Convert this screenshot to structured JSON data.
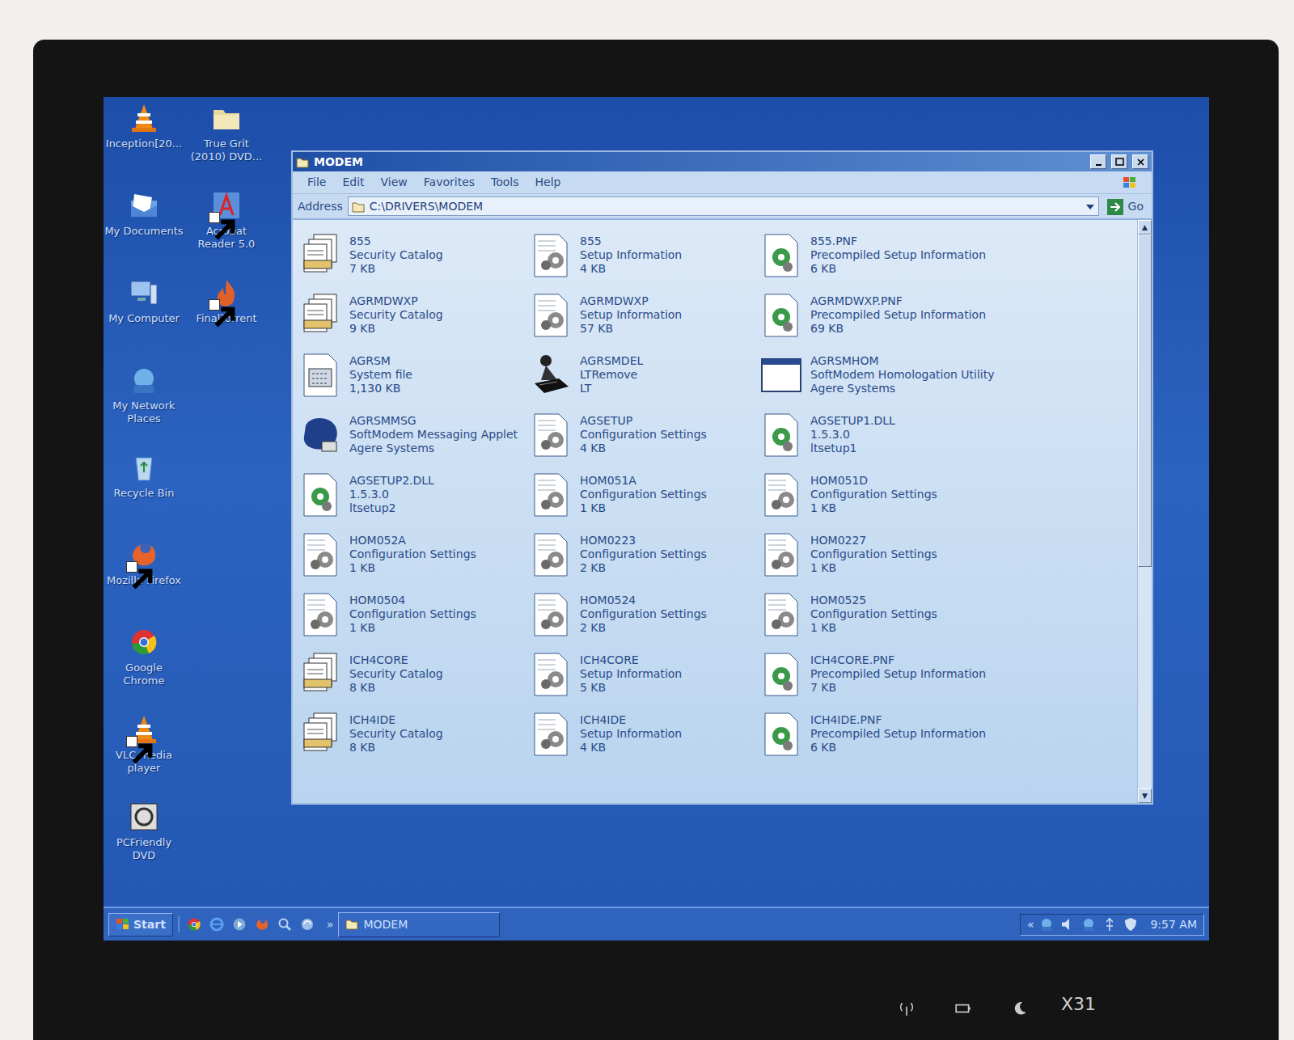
{
  "desktop": {
    "icons": [
      {
        "label": "Inception[20...",
        "kind": "vlc",
        "shortcut": false
      },
      {
        "label": "True Grit (2010) DVD...",
        "kind": "folder",
        "shortcut": false
      },
      {
        "label": "My Documents",
        "kind": "documents",
        "shortcut": false
      },
      {
        "label": "Acrobat Reader 5.0",
        "kind": "acrobat",
        "shortcut": true
      },
      {
        "label": "My Computer",
        "kind": "computer",
        "shortcut": false
      },
      {
        "label": "FinalTorrent",
        "kind": "torrent",
        "shortcut": true
      },
      {
        "label": "My Network Places",
        "kind": "network",
        "shortcut": false
      },
      {
        "label": "Recycle Bin",
        "kind": "recycle",
        "shortcut": false
      },
      {
        "label": "Mozilla Firefox",
        "kind": "firefox",
        "shortcut": true
      },
      {
        "label": "Google Chrome",
        "kind": "chrome",
        "shortcut": false
      },
      {
        "label": "VLC media player",
        "kind": "vlc",
        "shortcut": true
      },
      {
        "label": "PCFriendly DVD",
        "kind": "dvd",
        "shortcut": false
      }
    ]
  },
  "window": {
    "title": "MODEM",
    "menu": [
      "File",
      "Edit",
      "View",
      "Favorites",
      "Tools",
      "Help"
    ],
    "address_label": "Address",
    "address": "C:\\DRIVERS\\MODEM",
    "go": "Go",
    "scroll": {
      "level": 0.6
    }
  },
  "files": [
    {
      "name": "855",
      "lines": [
        "Security Catalog",
        "7 KB"
      ],
      "kind": "catalog"
    },
    {
      "name": "855",
      "lines": [
        "Setup Information",
        "4 KB"
      ],
      "kind": "setup"
    },
    {
      "name": "855.PNF",
      "lines": [
        "Precompiled Setup Information",
        "6 KB"
      ],
      "kind": "pnf"
    },
    {
      "name": "AGRMDWXP",
      "lines": [
        "Security Catalog",
        "9 KB"
      ],
      "kind": "catalog"
    },
    {
      "name": "AGRMDWXP",
      "lines": [
        "Setup Information",
        "57 KB"
      ],
      "kind": "setup"
    },
    {
      "name": "AGRMDWXP.PNF",
      "lines": [
        "Precompiled Setup Information",
        "69 KB"
      ],
      "kind": "pnf"
    },
    {
      "name": "AGRSM",
      "lines": [
        "System file",
        "1,130 KB"
      ],
      "kind": "system"
    },
    {
      "name": "AGRSMDEL",
      "lines": [
        "LTRemove",
        "LT"
      ],
      "kind": "remove"
    },
    {
      "name": "AGRSMHOM",
      "lines": [
        "SoftModem Homologation Utility",
        "Agere Systems"
      ],
      "kind": "app"
    },
    {
      "name": "AGRSMMSG",
      "lines": [
        "SoftModem Messaging Applet",
        "Agere Systems"
      ],
      "kind": "applet"
    },
    {
      "name": "AGSETUP",
      "lines": [
        "Configuration Settings",
        "4 KB"
      ],
      "kind": "setup"
    },
    {
      "name": "AGSETUP1.DLL",
      "lines": [
        "1.5.3.0",
        "ltsetup1"
      ],
      "kind": "pnf"
    },
    {
      "name": "AGSETUP2.DLL",
      "lines": [
        "1.5.3.0",
        "ltsetup2"
      ],
      "kind": "pnf"
    },
    {
      "name": "HOM051A",
      "lines": [
        "Configuration Settings",
        "1 KB"
      ],
      "kind": "setup"
    },
    {
      "name": "HOM051D",
      "lines": [
        "Configuration Settings",
        "1 KB"
      ],
      "kind": "setup"
    },
    {
      "name": "HOM052A",
      "lines": [
        "Configuration Settings",
        "1 KB"
      ],
      "kind": "setup"
    },
    {
      "name": "HOM0223",
      "lines": [
        "Configuration Settings",
        "2 KB"
      ],
      "kind": "setup"
    },
    {
      "name": "HOM0227",
      "lines": [
        "Configuration Settings",
        "1 KB"
      ],
      "kind": "setup"
    },
    {
      "name": "HOM0504",
      "lines": [
        "Configuration Settings",
        "1 KB"
      ],
      "kind": "setup"
    },
    {
      "name": "HOM0524",
      "lines": [
        "Configuration Settings",
        "2 KB"
      ],
      "kind": "setup"
    },
    {
      "name": "HOM0525",
      "lines": [
        "Configuration Settings",
        "1 KB"
      ],
      "kind": "setup"
    },
    {
      "name": "ICH4CORE",
      "lines": [
        "Security Catalog",
        "8 KB"
      ],
      "kind": "catalog"
    },
    {
      "name": "ICH4CORE",
      "lines": [
        "Setup Information",
        "5 KB"
      ],
      "kind": "setup"
    },
    {
      "name": "ICH4CORE.PNF",
      "lines": [
        "Precompiled Setup Information",
        "7 KB"
      ],
      "kind": "pnf"
    },
    {
      "name": "ICH4IDE",
      "lines": [
        "Security Catalog",
        "8 KB"
      ],
      "kind": "catalog"
    },
    {
      "name": "ICH4IDE",
      "lines": [
        "Setup Information",
        "4 KB"
      ],
      "kind": "setup"
    },
    {
      "name": "ICH4IDE.PNF",
      "lines": [
        "Precompiled Setup Information",
        "6 KB"
      ],
      "kind": "pnf"
    }
  ],
  "taskbar": {
    "start": "Start",
    "quick_launch": [
      {
        "kind": "chrome"
      },
      {
        "kind": "ie"
      },
      {
        "kind": "media"
      },
      {
        "kind": "firefox"
      },
      {
        "kind": "search"
      },
      {
        "kind": "update"
      }
    ],
    "more": "»",
    "tasks": [
      {
        "label": "MODEM",
        "selected": false
      }
    ],
    "tray_expand": "«",
    "tray": [
      {
        "kind": "network"
      },
      {
        "kind": "speaker"
      },
      {
        "kind": "network"
      },
      {
        "kind": "usb"
      },
      {
        "kind": "shield"
      }
    ],
    "clock": "9:57 AM"
  },
  "laptop": {
    "model": "X31",
    "indicators": [
      {
        "kind": "wireless"
      },
      {
        "kind": "battery"
      },
      {
        "kind": "sleep"
      }
    ]
  }
}
